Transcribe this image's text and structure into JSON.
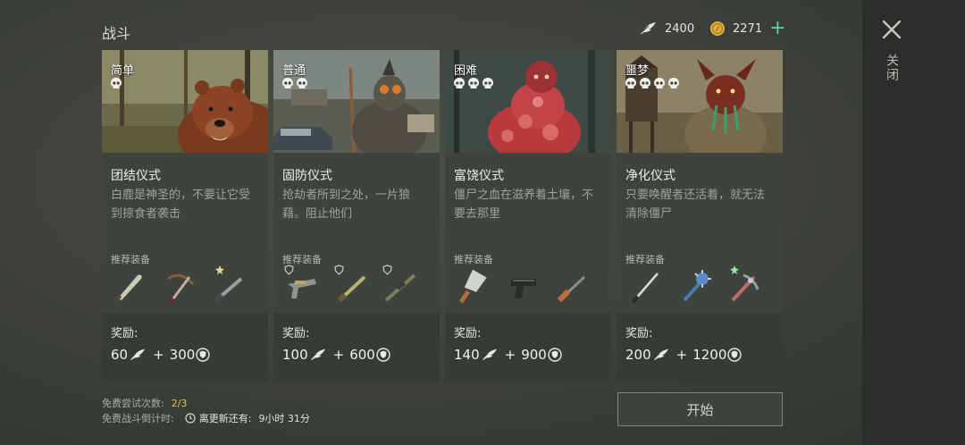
{
  "header": {
    "title": "战斗",
    "feathers": "2400",
    "coins": "2271"
  },
  "close": {
    "label": "关闭"
  },
  "cards": [
    {
      "difficulty": "简单",
      "skulls": 1,
      "name": "团结仪式",
      "description": "白鹿是神圣的，不要让它受到掠食者袭击",
      "rec_label": "推荐装备",
      "reward_label": "奖励:",
      "reward_feathers": "60",
      "reward_plus": "+",
      "reward_points": "300",
      "equipment": [
        "machete",
        "crossbow",
        "rifle"
      ]
    },
    {
      "difficulty": "普通",
      "skulls": 2,
      "name": "固防仪式",
      "description": "抢劫者所到之处，一片狼藉。阻止他们",
      "rec_label": "推荐装备",
      "reward_label": "奖励:",
      "reward_feathers": "100",
      "reward_plus": "+",
      "reward_points": "600",
      "equipment": [
        "heavy-pistol",
        "shotgun",
        "sniper-rifle"
      ]
    },
    {
      "difficulty": "困难",
      "skulls": 3,
      "name": "富饶仪式",
      "description": "僵尸之血在滋养着土壤，不要去那里",
      "rec_label": "推荐装备",
      "reward_label": "奖励:",
      "reward_feathers": "140",
      "reward_plus": "+",
      "reward_points": "900",
      "equipment": [
        "cleaver",
        "pistol",
        "hunting-rifle"
      ]
    },
    {
      "difficulty": "噩梦",
      "skulls": 4,
      "name": "净化仪式",
      "description": "只要唤醒者还活着，就无法清除僵尸",
      "rec_label": "推荐装备",
      "reward_label": "奖励:",
      "reward_feathers": "200",
      "reward_plus": "+",
      "reward_points": "1200",
      "equipment": [
        "katana",
        "spiked-mace",
        "heavy-crossbow"
      ]
    }
  ],
  "footer": {
    "attempts_label": "免费尝试次数:",
    "attempts_value": "2/3",
    "countdown_label": "免费战斗倒计时:",
    "refresh_label": "离更新还有:",
    "refresh_value": "9小时 31分"
  },
  "start_button": {
    "label": "开始"
  },
  "colors": {
    "accent_plus": "#4fd7a0",
    "attempts_highlight": "#e8c44e",
    "coin": "#e0b040"
  }
}
